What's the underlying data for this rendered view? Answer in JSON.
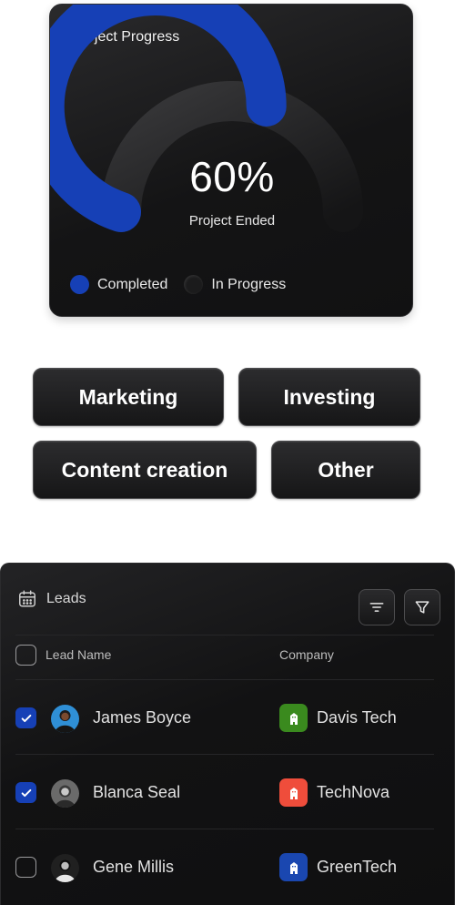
{
  "progress_card": {
    "title": "Project Progress",
    "percent_label": "60%",
    "percent_value": 0.6,
    "caption": "Project Ended",
    "colors": {
      "completed": "#1640b6",
      "in_progress": "#1b1b1c"
    },
    "legend": [
      {
        "label": "Completed"
      },
      {
        "label": "In Progress"
      }
    ]
  },
  "tags": [
    {
      "label": "Marketing"
    },
    {
      "label": "Investing"
    },
    {
      "label": "Content creation"
    },
    {
      "label": "Other"
    }
  ],
  "leads": {
    "title": "Leads",
    "header_icon": "calendar-icon",
    "actions": [
      "sort-icon",
      "filter-icon"
    ],
    "columns": {
      "lead_name": "Lead Name",
      "company": "Company"
    },
    "rows": [
      {
        "name": "James Boyce",
        "checked": true,
        "company": "Davis Tech",
        "company_color": "#3a8a1e",
        "avatar_bg": "#2f8fd6"
      },
      {
        "name": "Blanca Seal",
        "checked": true,
        "company": "TechNova",
        "company_color": "#ef4d3b",
        "avatar_bg": "#6a6a6a"
      },
      {
        "name": "Gene Millis",
        "checked": false,
        "company": "GreenTech",
        "company_color": "#1a47b0",
        "avatar_bg": "#202020"
      }
    ]
  }
}
